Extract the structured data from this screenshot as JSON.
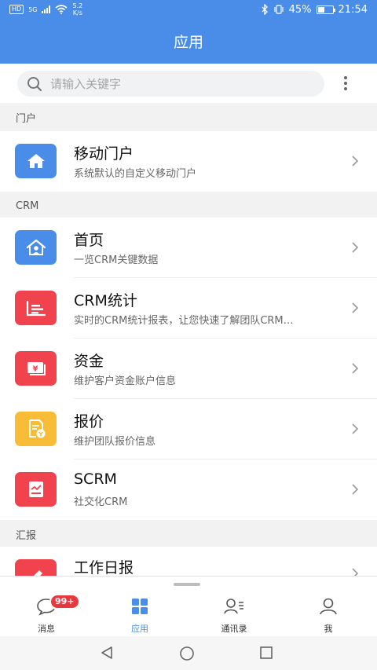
{
  "status": {
    "hd": "HD",
    "net": "5G",
    "speed_value": "5.2",
    "speed_unit": "K/s",
    "battery": "45%",
    "time": "21:54"
  },
  "header": {
    "title": "应用"
  },
  "search": {
    "placeholder": "请输入关键字"
  },
  "sections": {
    "portal": {
      "title": "门户",
      "items": [
        {
          "title": "移动门户",
          "subtitle": "系统默认的自定义移动门户",
          "icon": "home-icon",
          "color": "#4a8de8"
        }
      ]
    },
    "crm": {
      "title": "CRM",
      "items": [
        {
          "title": "首页",
          "subtitle": "一览CRM关键数据",
          "icon": "house-user-icon",
          "color": "#4a8de8"
        },
        {
          "title": "CRM统计",
          "subtitle": "实时的CRM统计报表，让您快速了解团队CRM…",
          "icon": "stats-report-icon",
          "color": "#f0434e"
        },
        {
          "title": "资金",
          "subtitle": "维护客户资金账户信息",
          "icon": "money-bill-icon",
          "color": "#f0434e"
        },
        {
          "title": "报价",
          "subtitle": "维护团队报价信息",
          "icon": "quote-document-icon",
          "color": "#f9bc36"
        },
        {
          "title": "SCRM",
          "subtitle": "社交化CRM",
          "icon": "chart-document-icon",
          "color": "#f0434e"
        }
      ]
    },
    "report": {
      "title": "汇报",
      "items": [
        {
          "title": "工作日报",
          "subtitle": "",
          "icon": "edit-report-icon",
          "color": "#f0434e"
        }
      ]
    }
  },
  "tabbar": {
    "badge": "99+",
    "tabs": [
      {
        "label": "消息",
        "icon": "chat-bubble-icon"
      },
      {
        "label": "应用",
        "icon": "apps-grid-icon",
        "active": true
      },
      {
        "label": "通讯录",
        "icon": "contacts-icon"
      },
      {
        "label": "我",
        "icon": "user-profile-icon"
      }
    ]
  }
}
